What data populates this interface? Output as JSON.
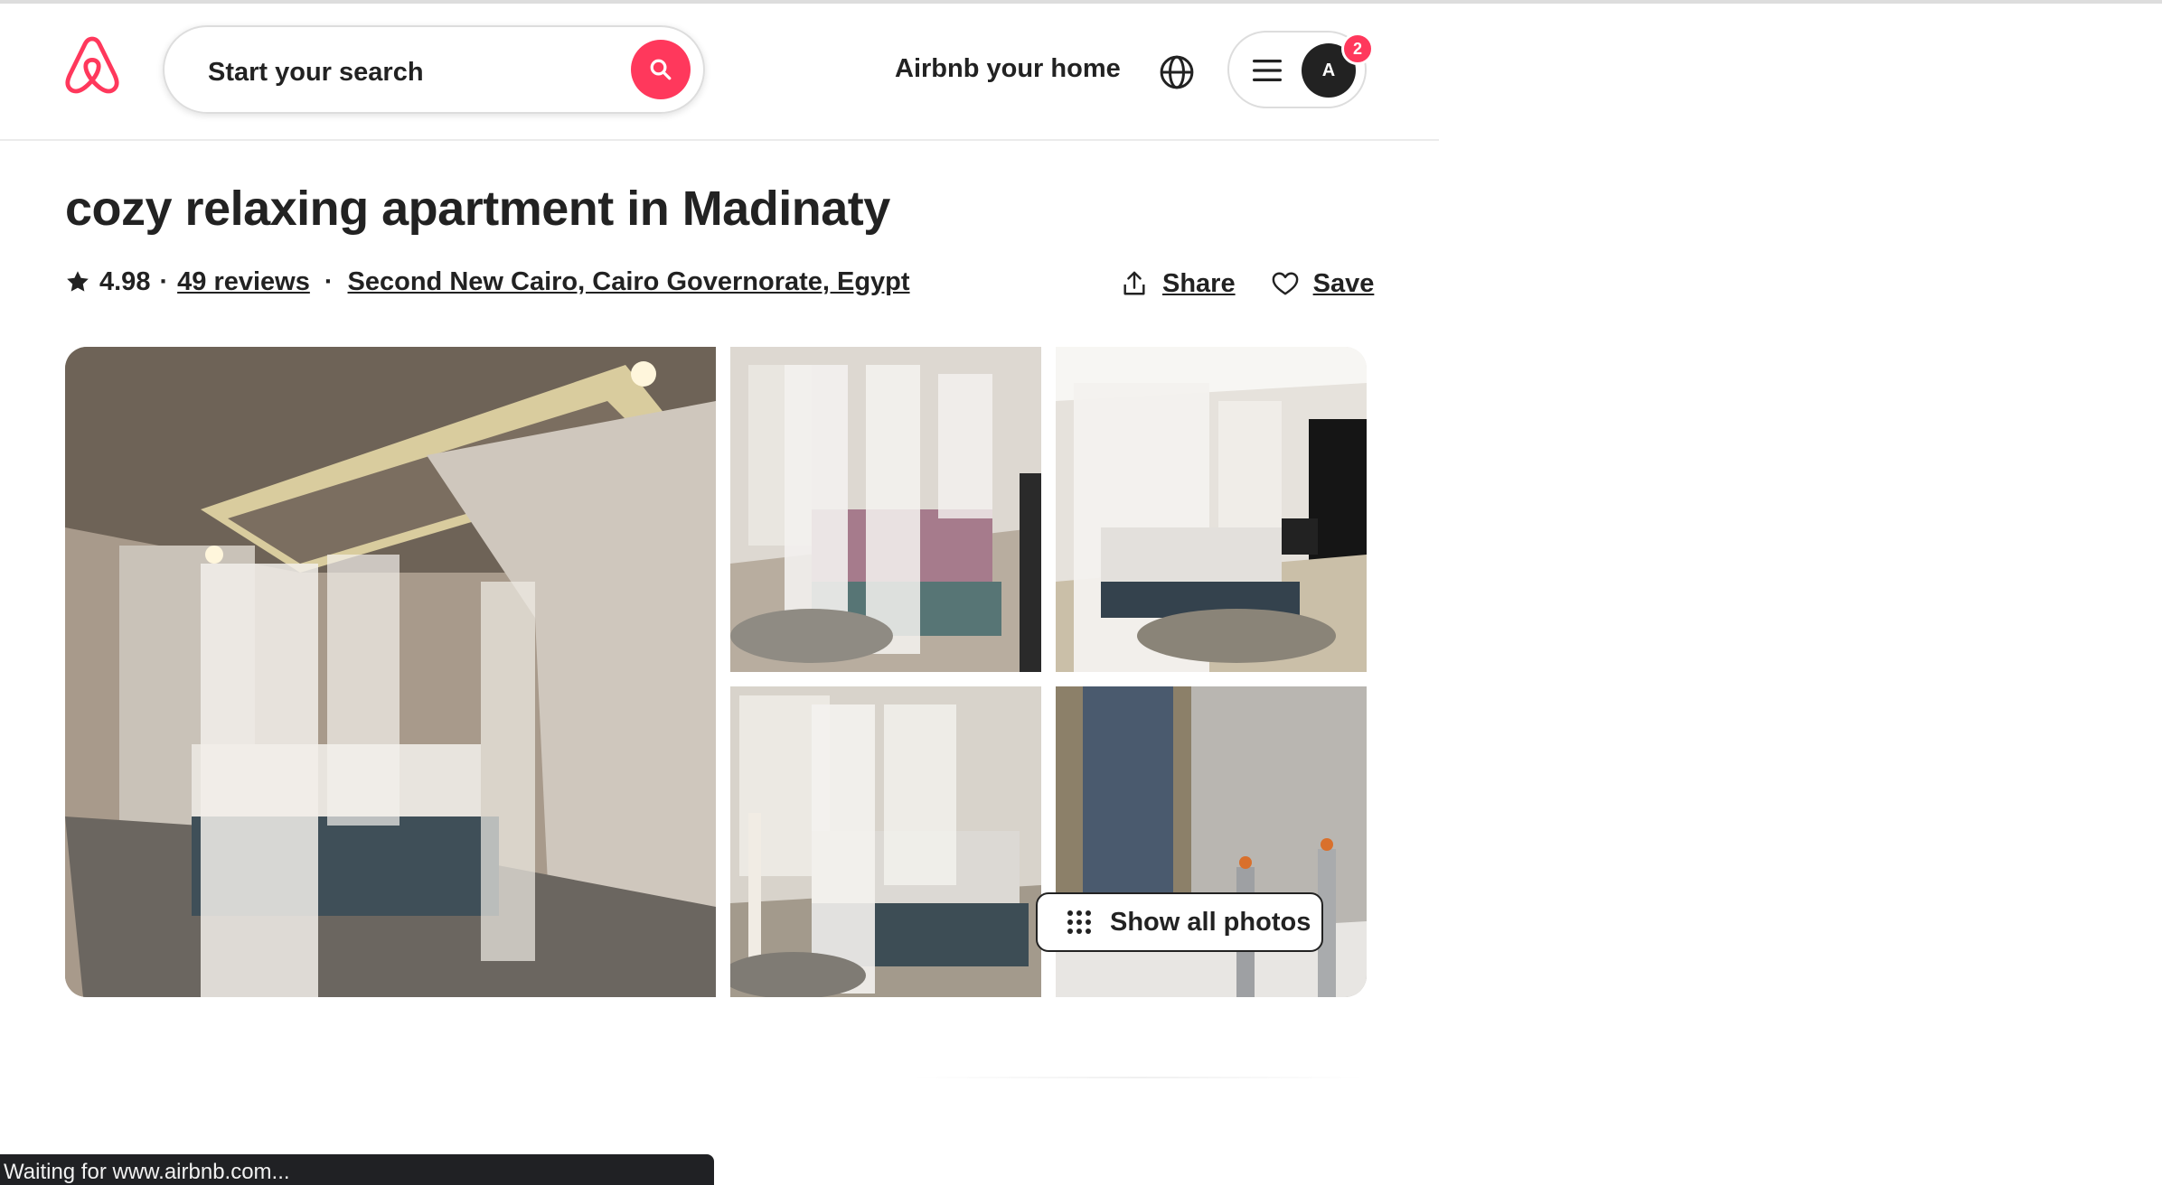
{
  "header": {
    "search_placeholder": "Start your search",
    "host_link": "Airbnb your home",
    "avatar_initial": "A",
    "notification_count": "2",
    "brand_color": "#ff385c"
  },
  "listing": {
    "title": "cozy relaxing apartment in Madinaty",
    "rating": "4.98",
    "dot1": "·",
    "reviews": "49 reviews",
    "dot2": "·",
    "location": "Second New Cairo, Cairo Governorate, Egypt",
    "share_label": "Share",
    "save_label": "Save"
  },
  "photos": {
    "show_all_label": "Show all photos"
  },
  "status_bar": {
    "text": "Waiting for www.airbnb.com..."
  },
  "icons": [
    "airbnb-logo-icon",
    "search-icon",
    "globe-icon",
    "hamburger-menu-icon",
    "star-icon",
    "share-icon",
    "heart-icon",
    "grid-dots-icon"
  ]
}
